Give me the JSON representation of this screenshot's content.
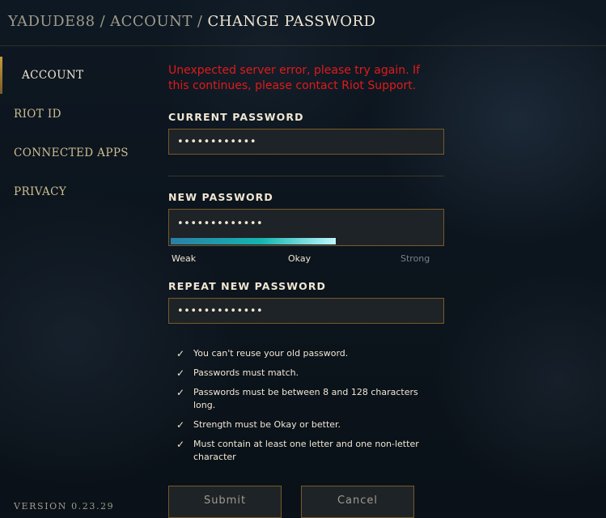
{
  "breadcrumb": {
    "items": [
      "YADUDE88",
      "ACCOUNT",
      "CHANGE PASSWORD"
    ],
    "separator": "/"
  },
  "sidebar": {
    "items": [
      {
        "label": "ACCOUNT",
        "active": true
      },
      {
        "label": "RIOT ID",
        "active": false
      },
      {
        "label": "CONNECTED APPS",
        "active": false
      },
      {
        "label": "PRIVACY",
        "active": false
      }
    ],
    "version": "VERSION 0.23.29"
  },
  "form": {
    "error": "Unexpected server error, please try again. If this continues, please contact Riot Support.",
    "current_password": {
      "label": "CURRENT PASSWORD",
      "value": "••••••••••••"
    },
    "new_password": {
      "label": "NEW PASSWORD",
      "value": "•••••••••••••"
    },
    "strength": {
      "labels": [
        "Weak",
        "Okay",
        "Strong"
      ],
      "level_percent": 61
    },
    "repeat_password": {
      "label": "REPEAT NEW PASSWORD",
      "value": "•••••••••••••"
    },
    "rules": [
      "You can't reuse your old password.",
      "Passwords must match.",
      "Passwords must be between 8 and 128 characters long.",
      "Strength must be Okay or better.",
      "Must contain at least one letter and one non-letter character"
    ],
    "check_glyph": "✓",
    "submit_label": "Submit",
    "cancel_label": "Cancel"
  },
  "colors": {
    "gold": "#c89b3c",
    "error": "#e01a1a",
    "text_light": "#f0e6d2",
    "field_bg": "#1e2328",
    "strength_start": "#2a7fa6",
    "strength_end": "#bff7ff"
  }
}
